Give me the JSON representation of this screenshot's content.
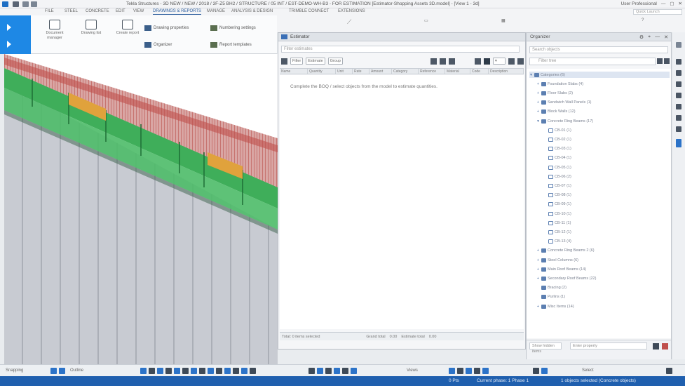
{
  "window": {
    "title": "Tekla Structures - 3D NEW / NEW / 2018 / 3F-Z5 BH2 / STRUCTURE / 05 INT / EST-DEMO-WH-B3 - FOR ESTIMATION [Estimator-Shopping Assets 3D.model] - [View 1 - 3d]",
    "user": "User Professional",
    "search_placeholder": "Quick Launch"
  },
  "ribbon": {
    "tabs": [
      "FILE",
      "STEEL",
      "CONCRETE",
      "EDIT",
      "VIEW",
      "DRAWINGS & REPORTS",
      "MANAGE",
      "ANALYSIS & DESIGN",
      "TRIMBLE CONNECT",
      "EXTENSIONS"
    ],
    "active_tab": "DRAWINGS & REPORTS",
    "groups": {
      "big1": "Document manager",
      "big2": "Drawing list",
      "big3": "Create report",
      "row1": "Drawing properties",
      "row2": "Numbering settings",
      "row3": "Organizer",
      "row4": "Report templates"
    }
  },
  "estimator": {
    "title": "Estimator",
    "search_placeholder": "Filter estimates",
    "toolbar": [
      "Filter",
      "Estimate",
      "Group"
    ],
    "columns": [
      "Name",
      "Quantity",
      "Unit",
      "Rate",
      "Amount",
      "Category",
      "Reference",
      "Material",
      "Code",
      "Description"
    ],
    "empty_message": "Complete the BOQ / select objects from the model to estimate quantities.",
    "footer": [
      "Total: 0 items selected",
      "Grand total",
      "0.00",
      "Estimate total",
      "0.00"
    ]
  },
  "tree": {
    "title": "Organizer",
    "search_placeholder": "Search objects",
    "search2_placeholder": "Filter tree",
    "items": [
      {
        "label": "Categories (6)",
        "level": 0,
        "toggle": "▾",
        "selected": true
      },
      {
        "label": "Foundation Slabs (4)",
        "level": 1,
        "toggle": "+"
      },
      {
        "label": "Floor Slabs (2)",
        "level": 1,
        "toggle": "+"
      },
      {
        "label": "Sandwich Wall Panels (1)",
        "level": 1,
        "toggle": "+"
      },
      {
        "label": "Block Walls (12)",
        "level": 1,
        "toggle": "+"
      },
      {
        "label": "Concrete Ring Beams (17)",
        "level": 1,
        "toggle": "▾"
      },
      {
        "label": "CB-01 (1)",
        "level": 2,
        "toggle": ""
      },
      {
        "label": "CB-02 (1)",
        "level": 2,
        "toggle": ""
      },
      {
        "label": "CB-03 (1)",
        "level": 2,
        "toggle": ""
      },
      {
        "label": "CB-04 (1)",
        "level": 2,
        "toggle": ""
      },
      {
        "label": "CB-05 (1)",
        "level": 2,
        "toggle": ""
      },
      {
        "label": "CB-06 (2)",
        "level": 2,
        "toggle": ""
      },
      {
        "label": "CB-07 (1)",
        "level": 2,
        "toggle": ""
      },
      {
        "label": "CB-08 (1)",
        "level": 2,
        "toggle": ""
      },
      {
        "label": "CB-09 (1)",
        "level": 2,
        "toggle": ""
      },
      {
        "label": "CB-10 (1)",
        "level": 2,
        "toggle": ""
      },
      {
        "label": "CB-11 (1)",
        "level": 2,
        "toggle": ""
      },
      {
        "label": "CB-12 (1)",
        "level": 2,
        "toggle": ""
      },
      {
        "label": "CB-13 (4)",
        "level": 2,
        "toggle": ""
      },
      {
        "label": "Concrete Ring Beams 2 (6)",
        "level": 1,
        "toggle": "+"
      },
      {
        "label": "Steel Columns (6)",
        "level": 1,
        "toggle": "+"
      },
      {
        "label": "Main Roof Beams (14)",
        "level": 1,
        "toggle": "+"
      },
      {
        "label": "Secondary Roof Beams (22)",
        "level": 1,
        "toggle": "+"
      },
      {
        "label": "Bracing (2)",
        "level": 1,
        "toggle": ""
      },
      {
        "label": "Purlins (1)",
        "level": 1,
        "toggle": ""
      },
      {
        "label": "Misc Items (14)",
        "level": 1,
        "toggle": "+"
      }
    ],
    "bottom_field": "Show hidden items",
    "bottom_placeholder": "Enter property"
  },
  "bottom_toolbar": {
    "snap_label": "Snapping",
    "outline_label": "Outline",
    "view_label": "Views",
    "select_label": "Select"
  },
  "status": {
    "items": [
      "0 Pts",
      "Current phase: 1 Phase 1",
      "1 objects selected (Concrete objects)"
    ]
  },
  "colors": {
    "accent": "#1e88e5",
    "status_bar": "#1f5fae",
    "beam_green": "#3fae5a",
    "beam_orange": "#e0a23c",
    "roof_red": "#c0504d",
    "wall_grey": "#c9ccd3"
  }
}
